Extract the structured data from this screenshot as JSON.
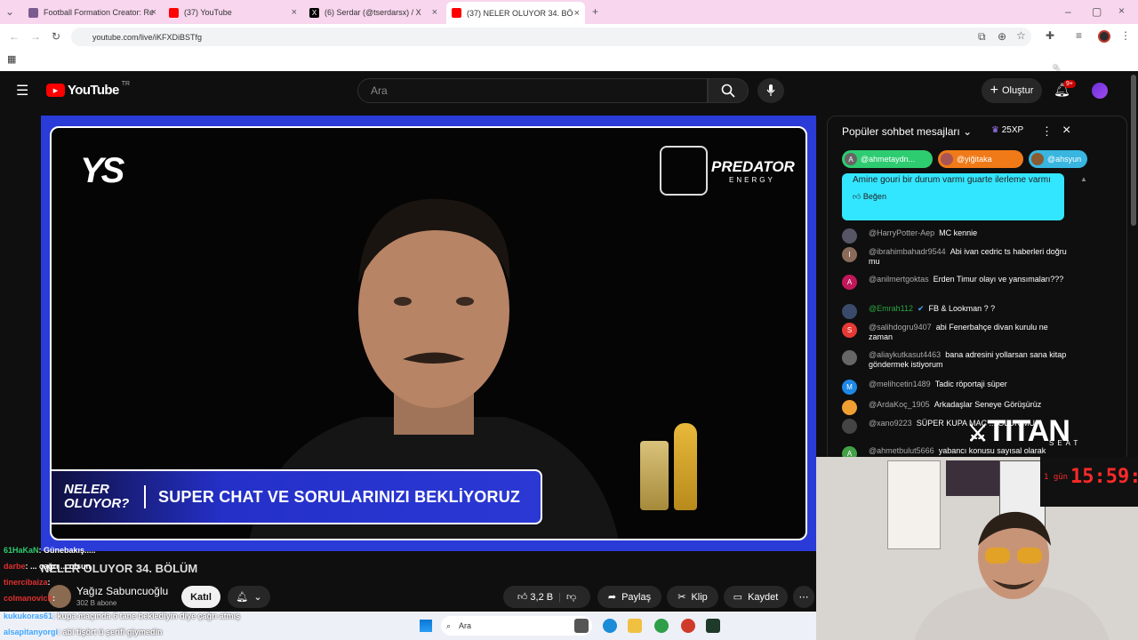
{
  "browser": {
    "tabs": [
      {
        "title": "Football Formation Creator: Re"
      },
      {
        "title": "(37) YouTube"
      },
      {
        "title": "(6) Serdar (@tserdarsx) / X"
      },
      {
        "title": "(37) NELER OLUYOR 34. BÖ"
      }
    ],
    "url": "youtube.com/live/iKFXDiBSTfg"
  },
  "youtube": {
    "logo_text": "YouTube",
    "region": "TR",
    "search_placeholder": "Ara",
    "create_label": "Oluştur",
    "notif_count": "9+"
  },
  "video": {
    "ys_logo": "YS",
    "sponsor": "PREDATOR",
    "sponsor_sub": "ENERGY",
    "banner_logo_line1": "NELER",
    "banner_logo_line2": "OLUYOR?",
    "banner_text": "SUPER CHAT VE SORULARINIZI BEKLİYORUZ"
  },
  "below_video": {
    "title": "NELER OLUYOR 34. BÖLÜM",
    "channel": "Yağız Sabuncuoğlu",
    "subscribers": "302 B abone",
    "join_label": "Katıl",
    "likes": "3,2 B",
    "share_label": "Paylaş",
    "clip_label": "Klip",
    "save_label": "Kaydet"
  },
  "chat": {
    "header": "Popüler sohbet mesajları",
    "xp_badge": "25XP",
    "chips": [
      {
        "name": "@ahmetaydn...",
        "color": "#2ecc71",
        "initial": "A"
      },
      {
        "name": "@yiğitaka",
        "color": "#f07a18",
        "initial": ""
      },
      {
        "name": "@ahsyun",
        "color": "#38b6e0",
        "initial": ""
      }
    ],
    "pinned_text": "Amine gouri bir durum varmı guarte ilerleme varmı",
    "pinned_like": "Beğen",
    "messages": [
      {
        "author": "@HarryPotter-Aep",
        "text": "MC kennie",
        "initial": "",
        "color": "#556"
      },
      {
        "author": "@ibrahimbahadr9544",
        "text": "Abi ivan cedric ts haberleri doğru mu",
        "initial": "I",
        "color": "#8a6b5a"
      },
      {
        "author": "@anilmertgoktas",
        "text": "Erden Timur olayı ve yansımaları???",
        "initial": "A",
        "color": "#c2185b"
      },
      {
        "author": "@Emrah112",
        "text": "FB & Lookman ? ?",
        "initial": "",
        "color": "#3a4a6a"
      },
      {
        "author": "@salihdogru9407",
        "text": "abi Fenerbahçe divan kurulu ne zaman",
        "initial": "S",
        "color": "#e53935"
      },
      {
        "author": "@aliaykutkasut4463",
        "text": "bana adresini yollarsan sana kitap göndermek istiyorum",
        "initial": "",
        "color": "#666"
      },
      {
        "author": "@melihcetin1489",
        "text": "Tadic röportaji süper",
        "initial": "M",
        "color": "#1e88e5"
      },
      {
        "author": "@ArdaKoç_1905",
        "text": "Arkadaşlar Seneye Görüşürüz",
        "initial": "",
        "color": "#f0a030"
      },
      {
        "author": "@xano9223",
        "text": "SÜPER KUPA MAÇ ... OLUR MU",
        "initial": "",
        "color": "#444"
      },
      {
        "author": "@ahmetbulut5666",
        "text": "yabancı konusu sayısal olarak",
        "initial": "A",
        "color": "#43a047"
      }
    ]
  },
  "webcam": {
    "brand": "TITAN",
    "brand_sub": "SEAT",
    "timer_label": "1 gün",
    "timer": "15:59:2"
  },
  "stream_overlay": [
    {
      "user": "61HaKaN",
      "text": ": Günebakış....."
    },
    {
      "user": "darbe",
      "text": ": ... çağrı ... olsun"
    },
    {
      "user": "tinercibaiza",
      "text": ":"
    },
    {
      "user": "colmanovich",
      "text": ":"
    },
    {
      "user": "kukukoras61",
      "text": ": kupa maçında 6 tane beklediyin diye çağrı atmış"
    },
    {
      "user": "alsapitanyorgi",
      "text": ": abi tişört ü şerifi giymedin"
    }
  ],
  "taskbar": {
    "search_placeholder": "Ara"
  }
}
